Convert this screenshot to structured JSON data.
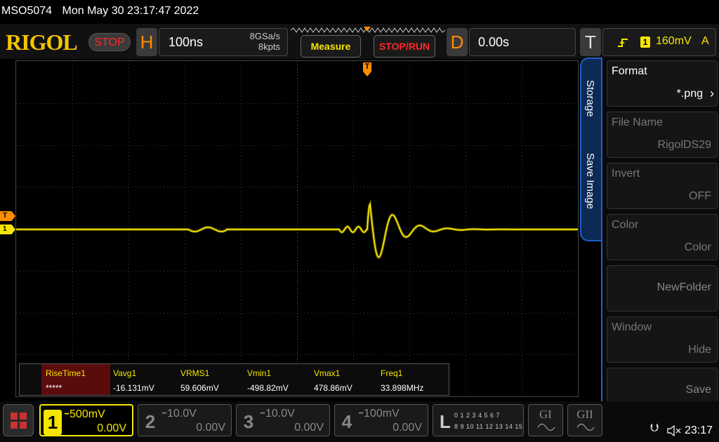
{
  "titlebar": {
    "model": "MSO5074",
    "datetime": "Mon May 30 23:17:47 2022"
  },
  "toolbar": {
    "logo": "RIGOL",
    "run_status": "STOP",
    "horizontal": {
      "letter": "H",
      "timebase": "100ns",
      "sample_rate": "8GSa/s",
      "memory_depth": "8kpts"
    },
    "measure_label": "Measure",
    "stoprun_label": "STOP/RUN",
    "delay": {
      "letter": "D",
      "value": "0.00s"
    },
    "trigger": {
      "letter": "T",
      "source": "1",
      "level": "160mV",
      "mode": "A"
    }
  },
  "markers": {
    "trigger": "T",
    "channel1": "1"
  },
  "measurements": [
    {
      "name": "RiseTime1",
      "value": "*****"
    },
    {
      "name": "Vavg1",
      "value": "-16.131mV"
    },
    {
      "name": "VRMS1",
      "value": "59.606mV"
    },
    {
      "name": "Vmin1",
      "value": "-498.82mV"
    },
    {
      "name": "Vmax1",
      "value": "478.86mV"
    },
    {
      "name": "Freq1",
      "value": "33.898MHz"
    }
  ],
  "menu": {
    "tabs": [
      "Storage",
      "Save Image"
    ],
    "items": [
      {
        "title": "Format",
        "value": "*.png"
      },
      {
        "title": "File Name",
        "value": "RigolDS29"
      },
      {
        "title": "Invert",
        "value": "OFF"
      },
      {
        "title": "Color",
        "value": "Color"
      },
      {
        "title": "",
        "value": "NewFolder"
      },
      {
        "title": "Window",
        "value": "Hide"
      },
      {
        "title": "",
        "value": "Save"
      }
    ]
  },
  "channels": [
    {
      "num": "1",
      "scale": "500mV",
      "offset": "0.00V"
    },
    {
      "num": "2",
      "scale": "10.0V",
      "offset": "0.00V"
    },
    {
      "num": "3",
      "scale": "10.0V",
      "offset": "0.00V"
    },
    {
      "num": "4",
      "scale": "100mV",
      "offset": "0.00V"
    }
  ],
  "logic": {
    "letter": "L",
    "row1": "0 1 2 3  4 5 6 7",
    "row2": "8 9 10 11 12 13 14 15"
  },
  "g1_label": "GI",
  "g2_label": "GII",
  "status": {
    "time": "23:17"
  },
  "colors": {
    "ch1": "#f5e600",
    "accent": "#1d5fc9",
    "trigger": "#ff8c00",
    "stop": "#ff2a2a"
  }
}
